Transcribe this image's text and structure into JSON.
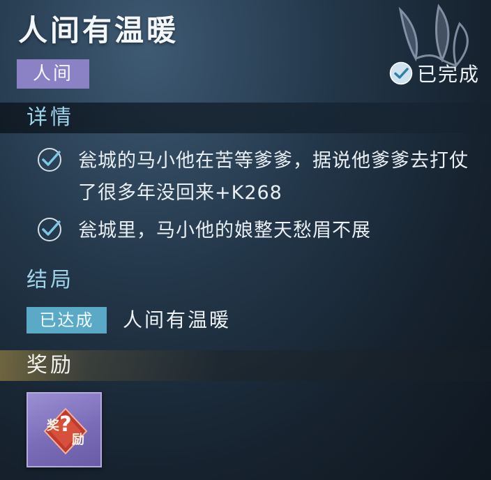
{
  "quest": {
    "title": "人间有温暖",
    "category": "人间",
    "status": "已完成"
  },
  "details": {
    "heading": "详情",
    "items": [
      {
        "text": "瓮城的马小他在苦等爹爹，据说他爹爹去打仗了很多年没回来+K268"
      },
      {
        "text": "瓮城里，马小他的娘整天愁眉不展"
      }
    ]
  },
  "ending": {
    "heading": "结局",
    "badge": "已达成",
    "text": "人间有温暖"
  },
  "reward": {
    "heading": "奖励",
    "items": [
      {
        "label_top": "奖",
        "label_bottom": "励",
        "symbol": "?"
      }
    ]
  },
  "colors": {
    "category_tag": "#8b82c6",
    "ending_badge": "#5aa9c6",
    "section_blue": "#9fd3ea",
    "reward_slot": "#7b6cb8",
    "check_accent": "#7ec6e6"
  },
  "icons": {
    "status": "check-circle-icon",
    "detail": "check-circle-icon",
    "emblem": "lotus-emblem",
    "reward": "mystery-reward-icon"
  }
}
